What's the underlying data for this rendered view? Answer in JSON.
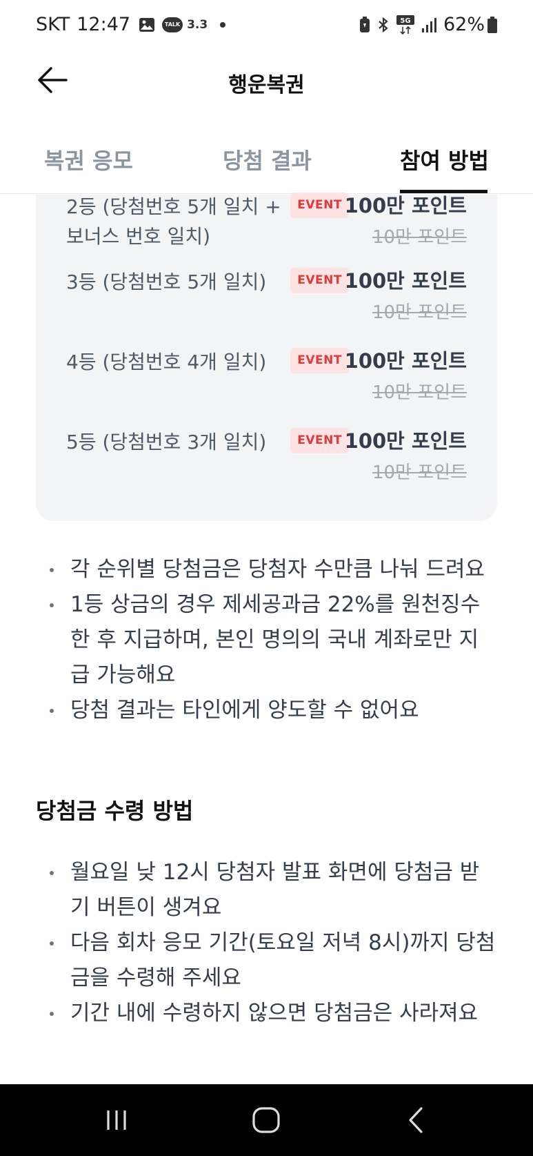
{
  "status_bar": {
    "carrier": "SKT",
    "time": "12:47",
    "talk_label": "TALK",
    "notification_count": "3.3",
    "network": "5G",
    "battery": "62%"
  },
  "header": {
    "title": "행운복권"
  },
  "tabs": [
    {
      "label": "복권 응모",
      "active": false
    },
    {
      "label": "당첨 결과",
      "active": false
    },
    {
      "label": "참여 방법",
      "active": true
    }
  ],
  "prizes": [
    {
      "rank": "2등 (당첨번호 5개 일치 + 보너스 번호 일치)",
      "badge": "EVENT",
      "new_amount": "100만 포인트",
      "old_amount": "10만 포인트"
    },
    {
      "rank": "3등 (당첨번호 5개 일치)",
      "badge": "EVENT",
      "new_amount": "100만 포인트",
      "old_amount": "10만 포인트"
    },
    {
      "rank": "4등 (당첨번호 4개 일치)",
      "badge": "EVENT",
      "new_amount": "100만 포인트",
      "old_amount": "10만 포인트"
    },
    {
      "rank": "5등 (당첨번호 3개 일치)",
      "badge": "EVENT",
      "new_amount": "100만 포인트",
      "old_amount": "10만 포인트"
    }
  ],
  "notes": [
    "각 순위별 당첨금은 당첨자 수만큼 나눠 드려요",
    "1등 상금의 경우 제세공과금 22%를 원천징수한 후 지급하며, 본인 명의의 국내 계좌로만 지급 가능해요",
    "당첨 결과는 타인에게 양도할 수 없어요"
  ],
  "claim_section": {
    "title": "당첨금 수령 방법",
    "items": [
      "월요일 낮 12시 당첨자 발표 화면에 당첨금 받기 버튼이 생겨요",
      "다음 회차 응모 기간(토요일 저녁 8시)까지 당첨금을 수령해 주세요",
      "기간 내에 수령하지 않으면 당첨금은 사라져요"
    ]
  },
  "colors": {
    "event_badge_bg": "#fde3e3",
    "event_badge_text": "#e03a3a",
    "card_bg": "#f2f4f6",
    "inactive_tab": "#8b95a1"
  },
  "icons": {
    "back": "arrow-left-icon",
    "nav_recent": "recent-apps-icon",
    "nav_home": "home-icon",
    "nav_back": "chevron-left-icon"
  }
}
